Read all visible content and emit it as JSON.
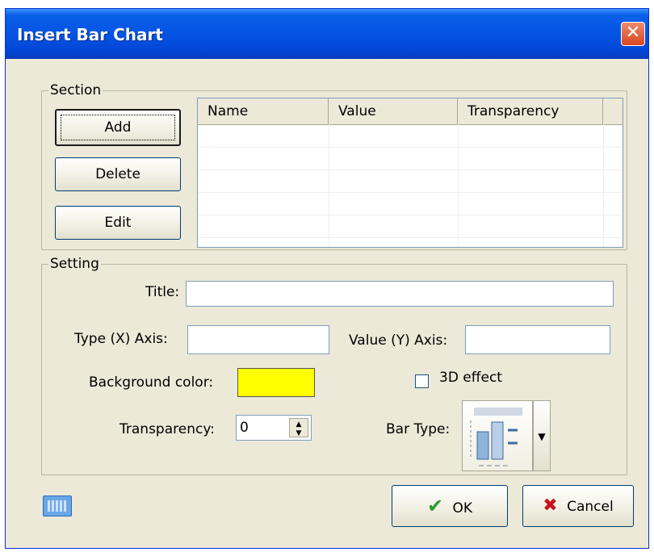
{
  "window": {
    "title": "Insert Bar Chart",
    "close_glyph": "✕"
  },
  "section": {
    "label": "Section",
    "add_label": "Add",
    "delete_label": "Delete",
    "edit_label": "Edit",
    "columns": [
      "Name",
      "Value",
      "Transparency"
    ]
  },
  "setting": {
    "label": "Setting",
    "title_label": "Title:",
    "title_value": "",
    "x_axis_label": "Type (X) Axis:",
    "x_axis_value": "",
    "y_axis_label": "Value (Y) Axis:",
    "y_axis_value": "",
    "bg_color_label": "Background color:",
    "bg_color": "#ffff00",
    "effect_label": "3D effect",
    "effect_checked": false,
    "transparency_label": "Transparency:",
    "transparency_value": "0",
    "bar_type_label": "Bar Type:",
    "bar_type_icon": "bar-chart-icon"
  },
  "footer": {
    "keyboard_icon": "keyboard-icon",
    "ok_label": "OK",
    "cancel_label": "Cancel",
    "ok_icon": "checkmark-icon",
    "cancel_icon": "x-mark-icon"
  }
}
